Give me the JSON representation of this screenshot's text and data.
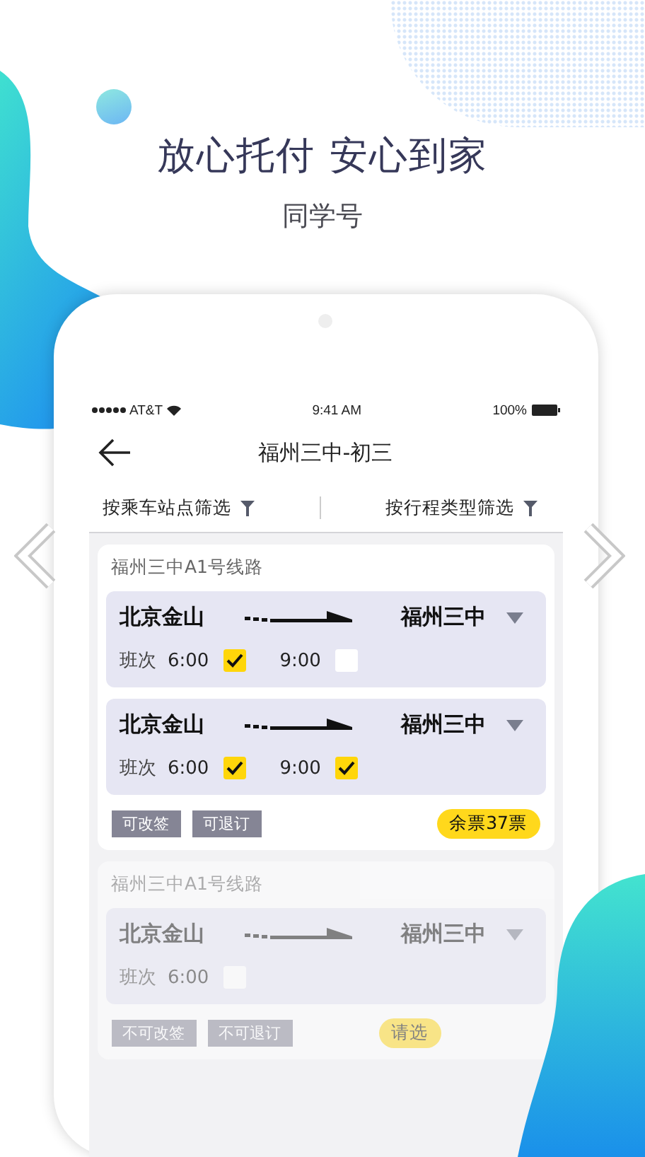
{
  "headline": "放心托付 安心到家",
  "subtitle": "同学号",
  "status_bar": {
    "carrier": "AT&T",
    "time": "9:41 AM",
    "battery": "100%"
  },
  "nav": {
    "title": "福州三中-初三"
  },
  "filters": [
    {
      "label": "按乘车站点筛选"
    },
    {
      "label": "按行程类型筛选"
    }
  ],
  "routes": [
    {
      "title": "福州三中A1号线路",
      "disabled": false,
      "trips": [
        {
          "from": "北京金山",
          "to": "福州三中",
          "label": "班次",
          "times": [
            {
              "time": "6:00",
              "checked": true
            },
            {
              "time": "9:00",
              "checked": false
            }
          ]
        },
        {
          "from": "北京金山",
          "to": "福州三中",
          "label": "班次",
          "times": [
            {
              "time": "6:00",
              "checked": true
            },
            {
              "time": "9:00",
              "checked": true
            }
          ]
        }
      ],
      "tags": [
        "可改签",
        "可退订"
      ],
      "badge": "余票37票"
    },
    {
      "title": "福州三中A1号线路",
      "disabled": true,
      "trips": [
        {
          "from": "北京金山",
          "to": "福州三中",
          "label": "班次",
          "times": [
            {
              "time": "6:00",
              "checked": false
            }
          ]
        }
      ],
      "tags": [
        "不可改签",
        "不可退订"
      ],
      "badge": "请选"
    }
  ]
}
